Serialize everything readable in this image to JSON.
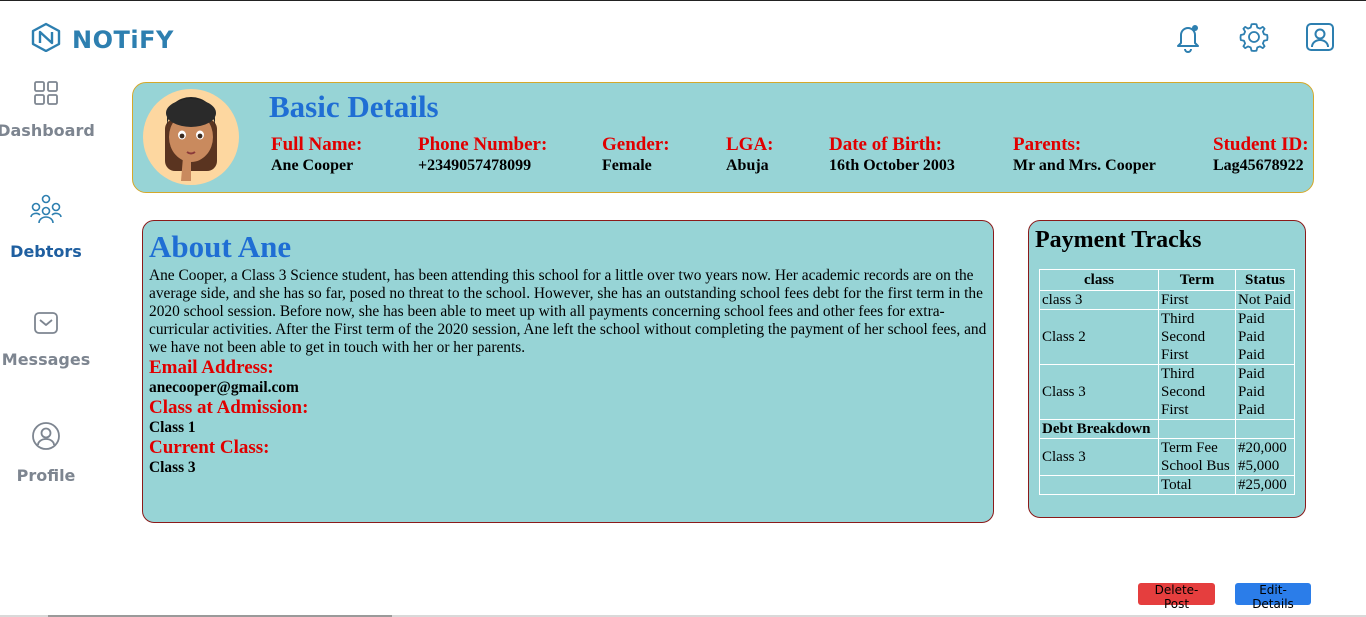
{
  "brand": {
    "name": "NOTiFY",
    "accent": "#2d7fb0"
  },
  "header_icons": [
    "bell-icon",
    "gear-icon",
    "user-profile-icon"
  ],
  "sidebar": {
    "items": [
      {
        "label": "Dashboard",
        "icon": "grid-icon",
        "active": false
      },
      {
        "label": "Debtors",
        "icon": "group-icon",
        "active": true
      },
      {
        "label": "Messages",
        "icon": "envelope-icon",
        "active": false
      },
      {
        "label": "Profile",
        "icon": "user-circle-icon",
        "active": false
      }
    ]
  },
  "basic_details": {
    "title": "Basic Details",
    "fields": [
      {
        "label": "Full Name:",
        "value": "Ane Cooper"
      },
      {
        "label": "Phone Number:",
        "value": "+2349057478099"
      },
      {
        "label": "Gender:",
        "value": "Female"
      },
      {
        "label": "LGA:",
        "value": "Abuja"
      },
      {
        "label": "Date of Birth:",
        "value": "16th October 2003"
      },
      {
        "label": "Parents:",
        "value": "Mr and Mrs. Cooper"
      },
      {
        "label": "Student ID:",
        "value": "Lag45678922"
      }
    ]
  },
  "about": {
    "title": "About Ane",
    "body": "Ane Cooper, a Class 3 Science student, has been attending this school for a little over two years now. Her academic records are on the average side, and she has so far, posed no threat to the school. However, she has an outstanding school fees debt for the first term in the 2020 school session. Before now, she has been able to meet up with all payments concerning school fees and other fees for extra-curricular activities. After the First term of the 2020 session, Ane left the school without completing the payment of her school fees, and we have not been able to get in touch with her or her parents.",
    "email_label": "Email Address:",
    "email_value": "anecooper@gmail.com",
    "admission_label": "Class at Admission:",
    "admission_value": "Class 1",
    "current_label": "Current Class:",
    "current_value": "Class 3"
  },
  "payment": {
    "title": "Payment Tracks",
    "headers": [
      "class",
      "Term",
      "Status"
    ],
    "rows": [
      {
        "class": "class 3",
        "terms": [
          "First"
        ],
        "status": [
          "Not Paid"
        ]
      },
      {
        "class": "Class 2",
        "terms": [
          "Third",
          "Second",
          "First"
        ],
        "status": [
          "Paid",
          "Paid",
          "Paid"
        ]
      },
      {
        "class": "Class 3",
        "terms": [
          "Third",
          "Second",
          "First"
        ],
        "status": [
          "Paid",
          "Paid",
          "Paid"
        ]
      }
    ],
    "debt_title": "Debt Breakdown",
    "debt_class": "Class 3",
    "debt_items": [
      "Term Fee",
      "School Bus"
    ],
    "debt_amounts": [
      "#20,000",
      "#5,000"
    ],
    "total_label": "Total",
    "total_amount": "#25,000"
  },
  "actions": {
    "delete_label": "Delete-Post",
    "edit_label": "Edit-Details"
  },
  "colors": {
    "panel_bg": "#97d4d6",
    "heading_blue": "#1f6ed4",
    "label_red": "#e00000",
    "delete_red": "#e53e3e",
    "edit_blue": "#2b7de9"
  }
}
